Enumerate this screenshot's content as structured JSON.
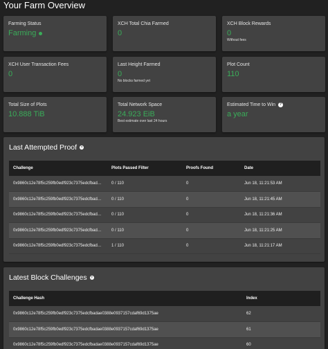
{
  "page": {
    "title": "Your Farm Overview"
  },
  "cards": {
    "farming_status": {
      "label": "Farming Status",
      "value": "Farming"
    },
    "total_chia_farmed": {
      "label": "XCH Total Chia Farmed",
      "value": "0"
    },
    "block_rewards": {
      "label": "XCH Block Rewards",
      "value": "0",
      "sub": "Without fees"
    },
    "user_fees": {
      "label": "XCH User Transaction Fees",
      "value": "0"
    },
    "last_height": {
      "label": "Last Height Farmed",
      "value": "0",
      "sub": "No blocks farmed yet"
    },
    "plot_count": {
      "label": "Plot Count",
      "value": "110"
    },
    "total_size": {
      "label": "Total Size of Plots",
      "value": "10.888 TiB"
    },
    "network_space": {
      "label": "Total Network Space",
      "value": "24.923 EiB",
      "sub": "Best estimate over last 24 hours"
    },
    "time_to_win": {
      "label": "Estimated Time to Win",
      "value": "a year"
    }
  },
  "last_attempted_proof": {
    "title": "Last Attempted Proof",
    "columns": [
      "Challenge",
      "Plots Passed Filter",
      "Proofs Found",
      "Date"
    ],
    "rows": [
      [
        "0x9860c12e78f5c259fb0edf923c7375edcfbad…",
        "0 / 110",
        "0",
        "Jun 18, 11:21:53 AM"
      ],
      [
        "0x9860c12e78f5c259fb0edf923c7375edcfbad…",
        "0 / 110",
        "0",
        "Jun 18, 11:21:45 AM"
      ],
      [
        "0x9860c12e78f5c259fb0edf923c7375edcfbad…",
        "0 / 110",
        "0",
        "Jun 18, 11:21:36 AM"
      ],
      [
        "0x9860c12e78f5c259fb0edf923c7375edcfbad…",
        "0 / 110",
        "0",
        "Jun 18, 11:21:25 AM"
      ],
      [
        "0x9860c12e78f5c259fb0edf923c7375edcfbad…",
        "1 / 110",
        "0",
        "Jun 18, 11:21:17 AM"
      ]
    ]
  },
  "latest_block_challenges": {
    "title": "Latest Block Challenges",
    "columns": [
      "Challenge Hash",
      "Index"
    ],
    "rows": [
      [
        "0x9860c12e78f5c259fb0edf923c7375edcfbadae0388e0937157cdaf69d1375ae",
        "62"
      ],
      [
        "0x9860c12e78f5c259fb0edf923c7375edcfbadae0388e0937157cdaf69d1375ae",
        "61"
      ],
      [
        "0x9860c12e78f5c259fb0edf923c7375edcfbadae0388e0937157cdaf69d1375ae",
        "60"
      ]
    ]
  },
  "colors": {
    "accent_green": "#3aac59",
    "card_bg": "#424242",
    "page_bg": "#212121"
  }
}
